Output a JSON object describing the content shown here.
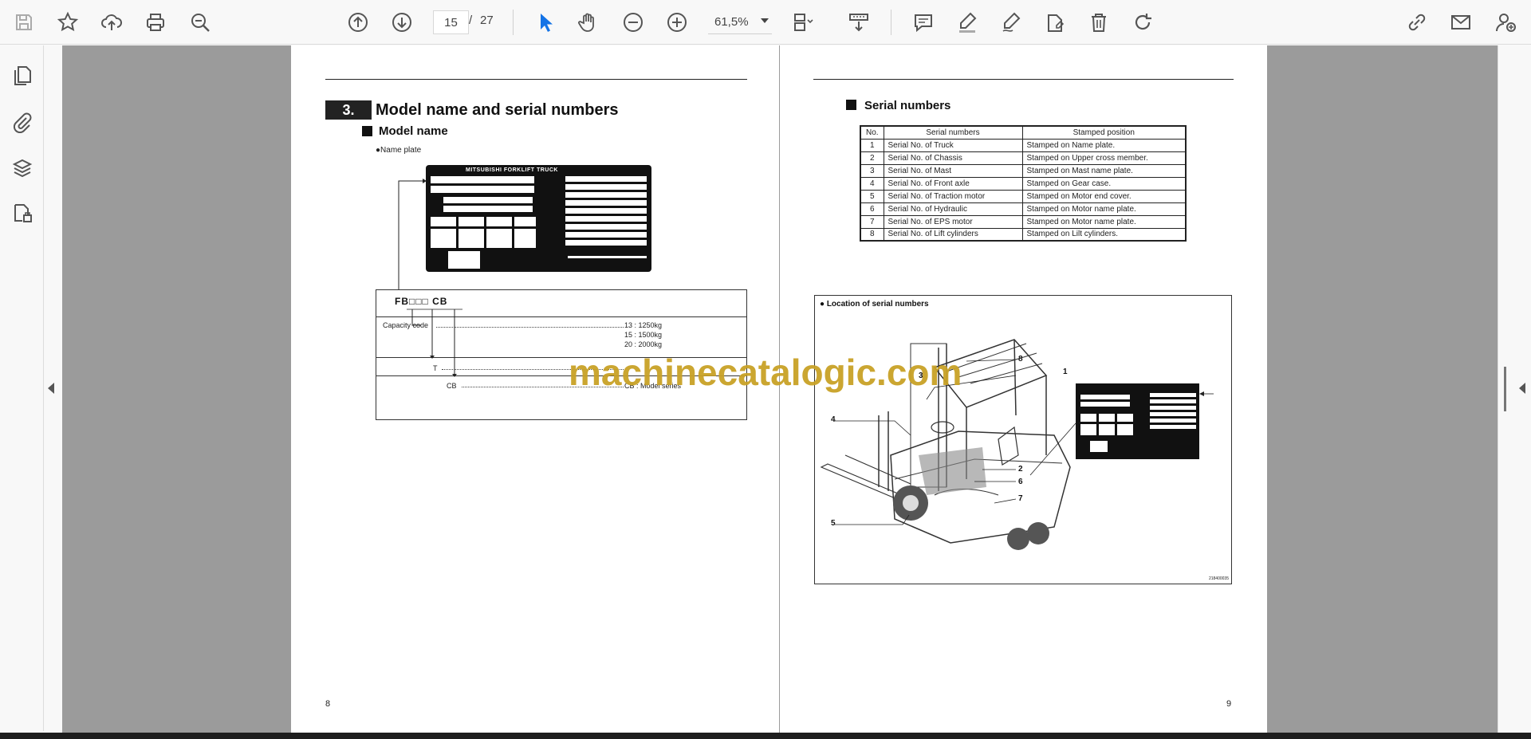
{
  "toolbar": {
    "page_current": "15",
    "page_separator": "/",
    "page_total": "27",
    "zoom": "61,5%",
    "icons": [
      "save-icon",
      "bookmark-star-icon",
      "upload-cloud-icon",
      "print-icon",
      "find-icon",
      "prev-page-icon",
      "next-page-icon",
      "select-cursor-icon",
      "hand-tool-icon",
      "zoom-out-icon",
      "zoom-in-icon",
      "fit-page-icon",
      "scroll-mode-icon",
      "comment-icon",
      "highlight-icon",
      "draw-icon",
      "stamp-icon",
      "delete-icon",
      "rotate-icon",
      "share-link-icon",
      "email-icon",
      "add-user-icon"
    ]
  },
  "sidebar": {
    "icons": [
      "pages-thumbnail-icon",
      "attachments-icon",
      "layers-icon",
      "signatures-icon"
    ]
  },
  "left_page": {
    "section_number": "3.",
    "section_title": "Model name and serial numbers",
    "subsection": "Model name",
    "bullet": "●Name plate",
    "nameplate_title": "MITSUBISHI FORKLIFT TRUCK",
    "model_code": "FB□□□ CB",
    "capacity_label": "Capacity code",
    "capacity_values": [
      "13 : 1250kg",
      "15 : 1500kg",
      "20 : 2000kg"
    ],
    "t_label": "T",
    "cb_label": "CB",
    "cb_value": "CB : Model series",
    "page_number": "8"
  },
  "right_page": {
    "subsection": "Serial numbers",
    "table_headers": [
      "No.",
      "Serial numbers",
      "Stamped position"
    ],
    "table_rows": [
      [
        "1",
        "Serial No. of Truck",
        "Stamped on Name plate."
      ],
      [
        "2",
        "Serial No. of Chassis",
        "Stamped on Upper cross member."
      ],
      [
        "3",
        "Serial No. of Mast",
        "Stamped on Mast name plate."
      ],
      [
        "4",
        "Serial No. of Front axle",
        "Stamped on Gear case."
      ],
      [
        "5",
        "Serial No. of Traction motor",
        "Stamped on Motor end cover."
      ],
      [
        "6",
        "Serial No. of Hydraulic",
        "Stamped on Motor name plate."
      ],
      [
        "7",
        "Serial No. of EPS motor",
        "Stamped on Motor name plate."
      ],
      [
        "8",
        "Serial No. of Lift cylinders",
        "Stamped on Lilt cylinders."
      ]
    ],
    "figure_title": "● Location of serial numbers",
    "callouts": [
      "1",
      "2",
      "3",
      "4",
      "5",
      "6",
      "7",
      "8"
    ],
    "figure_code": "218400035",
    "page_number": "9"
  },
  "watermark": "machinecatalogic.com",
  "colors": {
    "viewer_bg": "#9b9b9b",
    "toolbar_bg": "#f8f8f8",
    "accent": "#1473e6",
    "watermark": "#c9a227"
  }
}
